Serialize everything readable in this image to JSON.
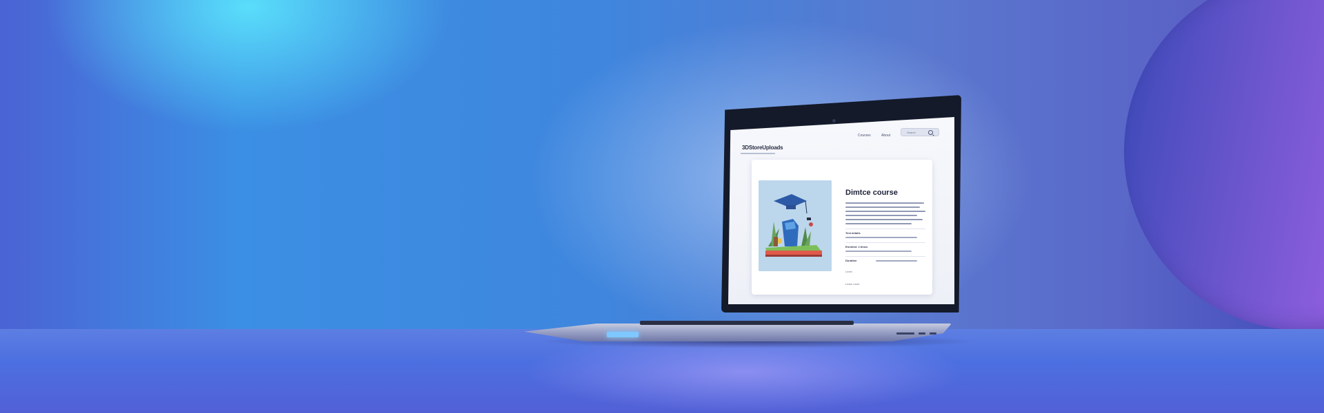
{
  "site": {
    "brand": "3DStoreUploads",
    "nav": {
      "link1": "Courses",
      "link2": "About",
      "search_placeholder": "Search"
    }
  },
  "course_card": {
    "title": "Dimtce course",
    "meta": [
      {
        "label": "Text details"
      },
      {
        "label": "Enrolled: 2 times"
      },
      {
        "label": "Duration"
      }
    ],
    "footer_note": "Level",
    "footer_note_2": "Learn more"
  },
  "colors": {
    "wall_left": "#4b63d4",
    "wall_cyan": "#5febff",
    "wall_right": "#5b57c2",
    "arch_purple": "#b86cf0",
    "floor": "#4c6fe0",
    "laptop_bezel": "#141a2a",
    "trackpad_glow": "#7ec8ff"
  },
  "icons": {
    "search": "search-icon",
    "illustration": "graduation-cap-illustration"
  }
}
